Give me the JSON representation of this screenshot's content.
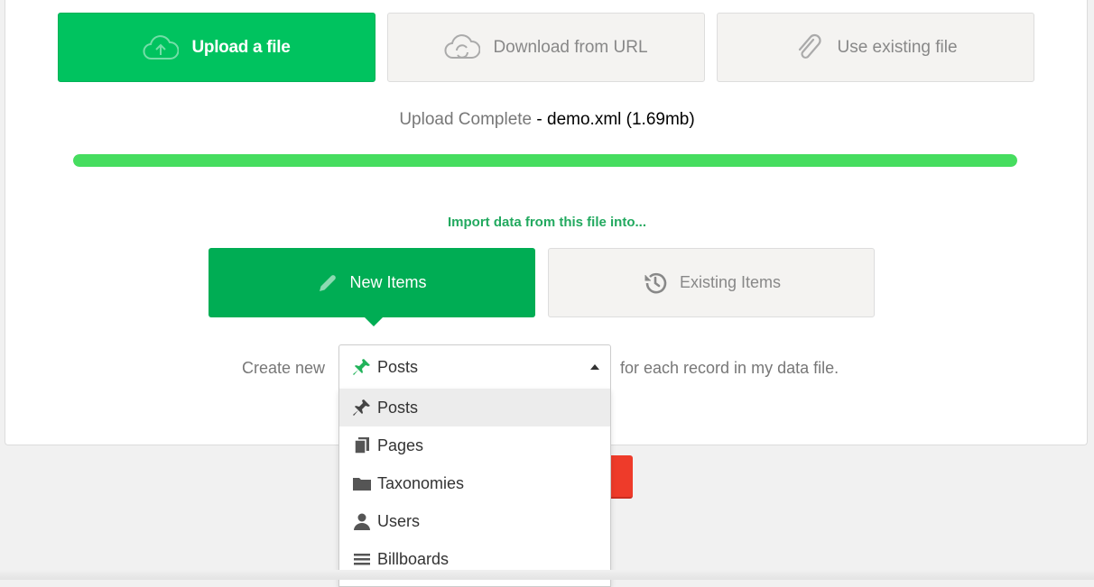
{
  "source_tabs": {
    "upload": "Upload a file",
    "download": "Download from URL",
    "existing": "Use existing file"
  },
  "status": {
    "label": "Upload Complete",
    "file": " - demo.xml (1.69mb)",
    "progress_percent": 100
  },
  "import": {
    "label": "Import data from this file into..."
  },
  "target_tabs": {
    "new": "New Items",
    "existing": "Existing Items"
  },
  "create": {
    "prefix": "Create new",
    "selected": "Posts",
    "suffix": "for each record in my data file."
  },
  "dropdown": {
    "items": [
      {
        "label": "Posts",
        "icon": "pin-icon",
        "selected": true
      },
      {
        "label": "Pages",
        "icon": "pages-icon",
        "selected": false
      },
      {
        "label": "Taxonomies",
        "icon": "folder-icon",
        "selected": false
      },
      {
        "label": "Users",
        "icon": "user-icon",
        "selected": false
      },
      {
        "label": "Billboards",
        "icon": "list-icon",
        "selected": false
      }
    ]
  },
  "colors": {
    "accent_green": "#00c35f",
    "progress_green": "#46dd5f",
    "label_green": "#22a95f",
    "danger_red": "#ee3b2a"
  }
}
